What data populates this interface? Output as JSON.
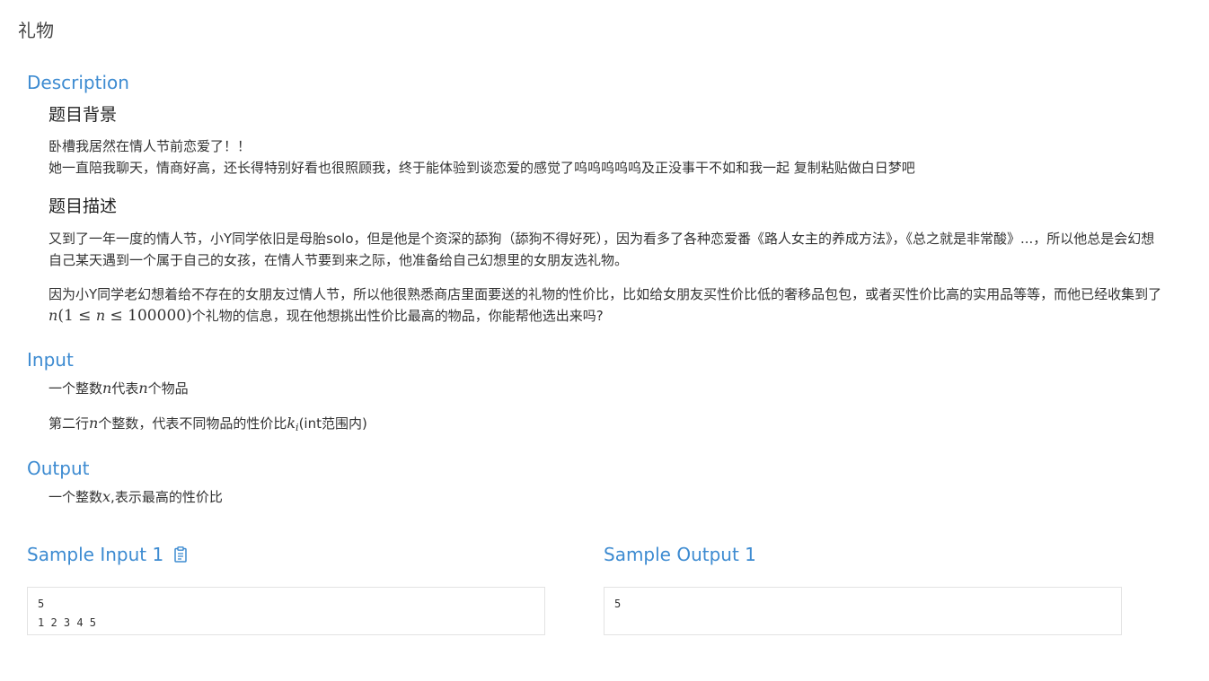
{
  "problem": {
    "title": "礼物"
  },
  "description": {
    "heading": "Description",
    "background_heading": "题目背景",
    "background_line1": "卧槽我居然在情人节前恋爱了！！",
    "background_line2": "她一直陪我聊天，情商好高，还长得特别好看也很照顾我，终于能体验到谈恋爱的感觉了呜呜呜呜呜及正没事干不如和我一起 复制粘贴做白日梦吧",
    "desc_heading": "题目描述",
    "desc_para1": "又到了一年一度的情人节，小Y同学依旧是母胎solo，但是他是个资深的舔狗（舔狗不得好死），因为看多了各种恋爱番《路人女主的养成方法》，《总之就是非常酸》...，所以他总是会幻想自己某天遇到一个属于自己的女孩，在情人节要到来之际，他准备给自己幻想里的女朋友选礼物。",
    "desc_para2_before": "因为小Y同学老幻想着给不存在的女朋友过情人节，所以他很熟悉商店里面要送的礼物的性价比，比如给女朋友买性价比低的奢移品包包，或者买性价比高的实用品等等，而他已经收集到了",
    "desc_para2_math_n": "n",
    "desc_para2_math_range": "(1 ≤ ",
    "desc_para2_math_n2": "n",
    "desc_para2_math_range2": " ≤ 100000)",
    "desc_para2_after": "个礼物的信息，现在他想挑出性价比最高的物品，你能帮他选出来吗?"
  },
  "input": {
    "heading": "Input",
    "line1_a": "一个整数",
    "line1_n": "n",
    "line1_b": "代表",
    "line1_n2": "n",
    "line1_c": "个物品",
    "line2_a": "第二行",
    "line2_n": "n",
    "line2_b": "个整数，代表不同物品的性价比",
    "line2_k": "k",
    "line2_i": "i",
    "line2_c": "(int范围内)"
  },
  "output": {
    "heading": "Output",
    "line1_a": "一个整数",
    "line1_x": "x",
    "line1_b": ",表示最高的性价比"
  },
  "samples": {
    "input_heading": "Sample Input 1",
    "output_heading": "Sample Output 1",
    "input_text": "5\n1 2 3 4 5",
    "output_text": "5",
    "copy_icon": "clipboard-icon"
  },
  "colors": {
    "accent": "#3d8bd1",
    "text": "#333333",
    "border": "#e3e3e3"
  }
}
